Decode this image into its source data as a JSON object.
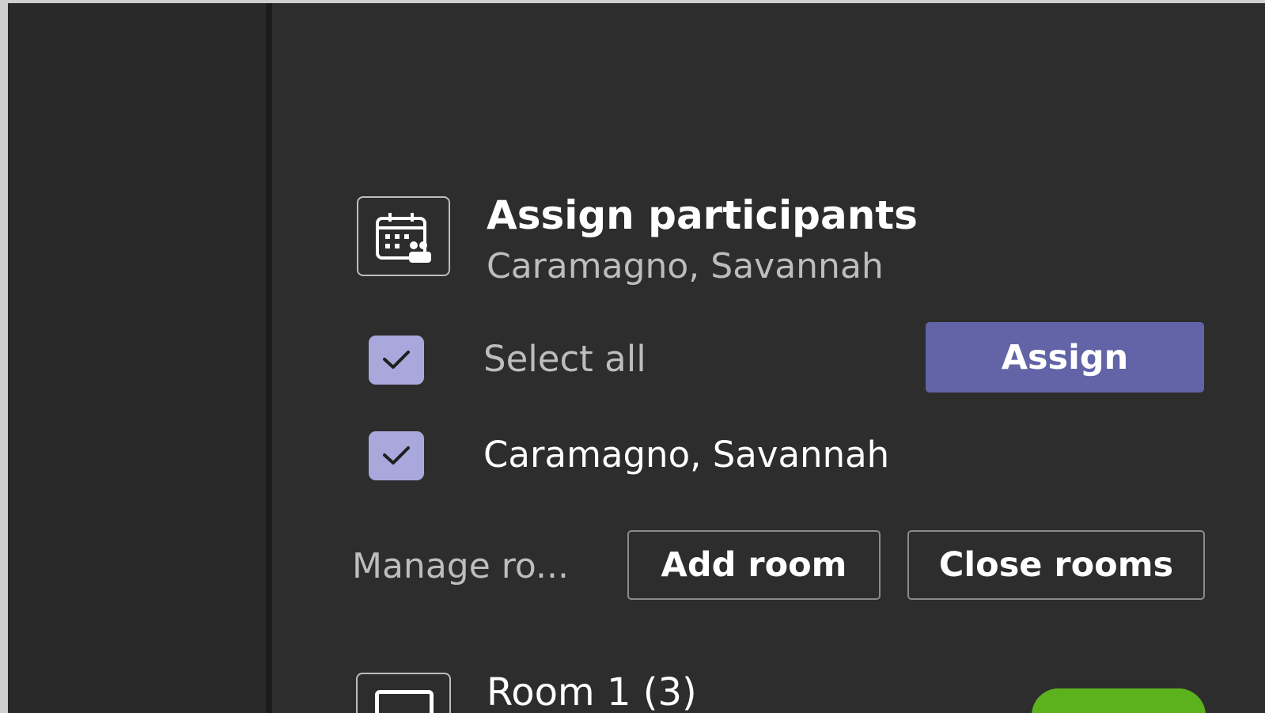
{
  "assign_panel": {
    "title": "Assign participants",
    "subtitle": "Caramagno, Savannah",
    "select_all_label": "Select all",
    "assign_label": "Assign",
    "participants": [
      {
        "name": "Caramagno, Savannah",
        "checked": true
      }
    ]
  },
  "manage_rooms": {
    "label": "Manage ro...",
    "add_room_label": "Add room",
    "close_rooms_label": "Close rooms"
  },
  "rooms": [
    {
      "title": "Room 1 (3)"
    }
  ],
  "colors": {
    "accent": "#6264a7",
    "checkbox": "#a9a8dc",
    "status_green": "#5cb21d"
  },
  "icons": {
    "header": "calendar-people-icon",
    "checkbox": "checkmark-icon",
    "room": "room-icon"
  }
}
